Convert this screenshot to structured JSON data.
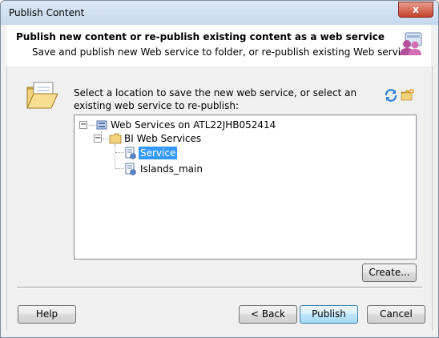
{
  "window": {
    "title": "Publish Content",
    "close_label": "x"
  },
  "header": {
    "title": "Publish new content or re-publish existing content as a web service",
    "subtitle": "Save and publish new Web service to folder, or re-publish existing Web service",
    "icon": "users-group-icon"
  },
  "body": {
    "instruction": "Select a location to save the new web service, or select an existing web service to re-publish:",
    "icons": [
      "open-folder-icon",
      "refresh-icon",
      "new-folder-icon"
    ]
  },
  "tree": {
    "root": {
      "label": "Web Services on ATL22JHB052414",
      "expanded": true,
      "icon": "server-icon"
    },
    "folder": {
      "label": "BI Web Services",
      "expanded": true,
      "icon": "folder-icon"
    },
    "items": [
      {
        "label": "Service",
        "selected": true,
        "icon": "web-service-icon"
      },
      {
        "label": "Islands_main",
        "selected": false,
        "icon": "web-service-icon"
      }
    ]
  },
  "buttons": {
    "create": "Create...",
    "help": "Help",
    "back": "< Back",
    "publish": "Publish",
    "cancel": "Cancel"
  },
  "colors": {
    "selection": "#3399ff",
    "titlebar": "#c7d8ee",
    "close": "#c6432e"
  }
}
